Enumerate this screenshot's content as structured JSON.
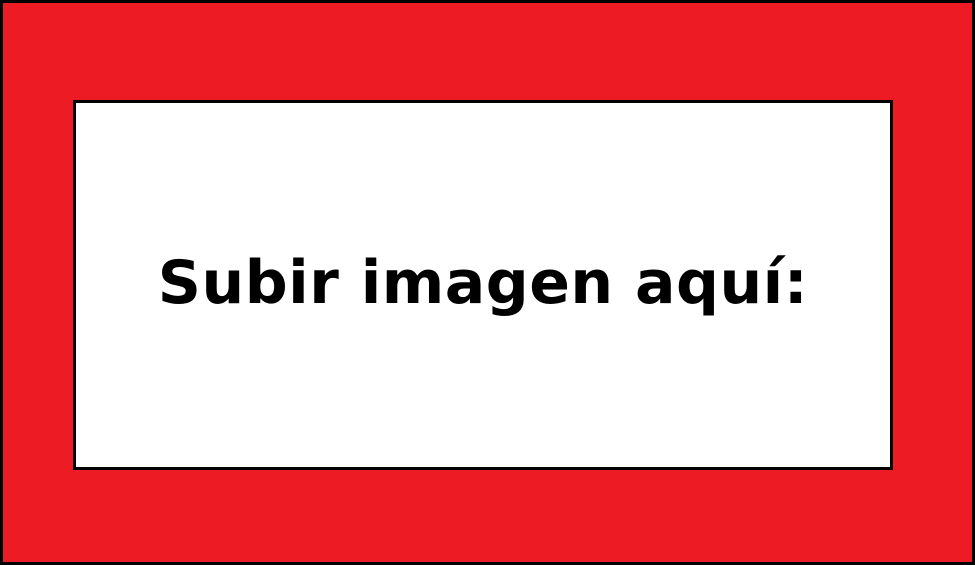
{
  "colors": {
    "frame_background": "#ED1C24",
    "border": "#000000",
    "dropzone_background": "#FFFFFF",
    "text": "#000000"
  },
  "upload": {
    "label": "Subir imagen aquí:"
  }
}
